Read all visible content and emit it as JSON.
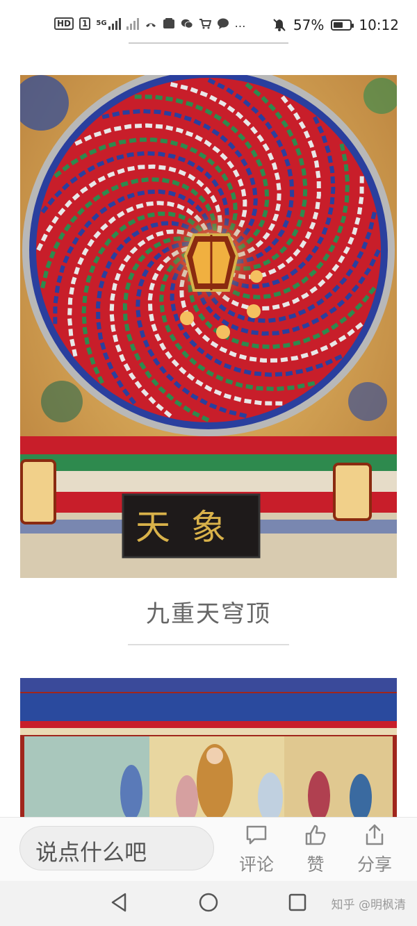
{
  "status_bar": {
    "hd_label": "HD",
    "sim_label": "1",
    "network": "5G",
    "battery_percent": 57,
    "battery_text": "57%",
    "time": "10:12",
    "more_icon": "…",
    "icons": [
      "missed-call-icon",
      "huawei-app-icon",
      "wechat-icon",
      "shopping-cart-icon",
      "message-icon"
    ]
  },
  "article": {
    "image1_alt_name": "dome-ceiling-photo",
    "plaque_text": "天象",
    "caption": "九重天穹顶",
    "image2_alt_name": "mural-photo"
  },
  "action_bar": {
    "comment_placeholder": "说点什么吧",
    "comment_label": "评论",
    "like_label": "赞",
    "share_label": "分享"
  },
  "nav_bar": {
    "watermark": "知乎 @明枫清"
  },
  "colors": {
    "dome_red": "#c81e2a",
    "dome_blue": "#2a3f9e",
    "dome_green": "#2e8a4e",
    "gold": "#d9b24a"
  }
}
